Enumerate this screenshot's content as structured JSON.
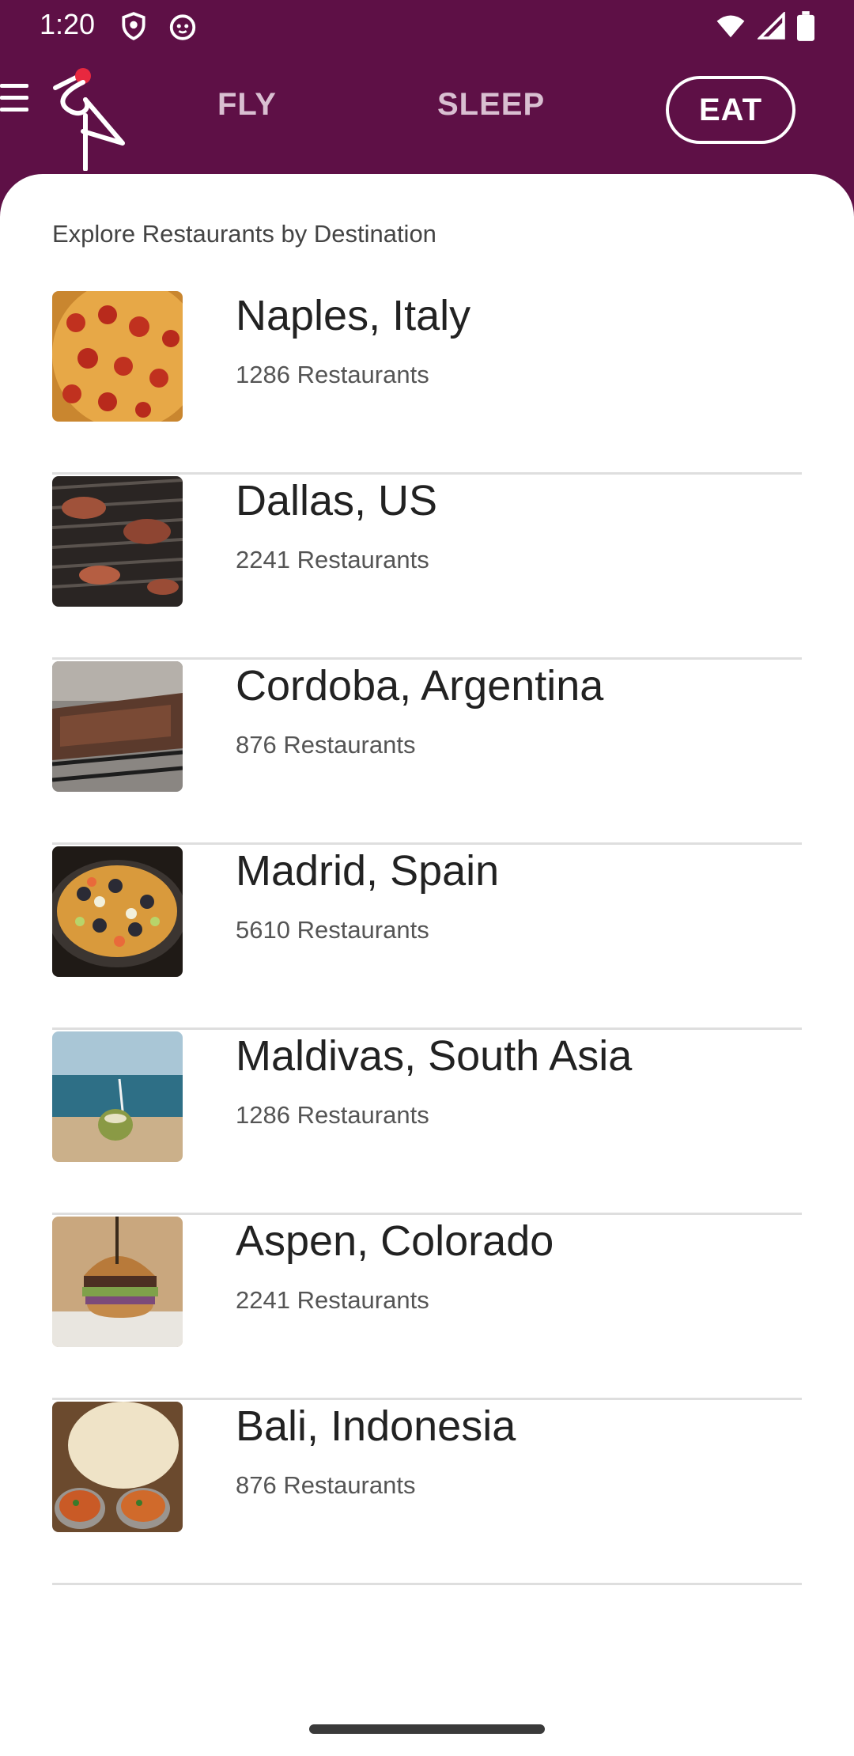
{
  "status_bar": {
    "time": "1:20",
    "icons": [
      "shield-icon",
      "cat-face-icon",
      "wifi-icon",
      "signal-icon",
      "battery-icon"
    ]
  },
  "nav": {
    "tabs": [
      {
        "label": "FLY",
        "selected": false
      },
      {
        "label": "SLEEP",
        "selected": false
      },
      {
        "label": "EAT",
        "selected": true
      }
    ]
  },
  "colors": {
    "brand": "#5e1046",
    "accent": "#e8283f",
    "sheet": "#ffffff"
  },
  "content": {
    "section_title": "Explore Restaurants by Destination",
    "destinations": [
      {
        "name": "Naples, Italy",
        "count": "1286 Restaurants",
        "image": "pizza-photo"
      },
      {
        "name": "Dallas, US",
        "count": "2241 Restaurants",
        "image": "grill-photo"
      },
      {
        "name": "Cordoba, Argentina",
        "count": "876 Restaurants",
        "image": "asado-photo"
      },
      {
        "name": "Madrid, Spain",
        "count": "5610 Restaurants",
        "image": "paella-photo"
      },
      {
        "name": "Maldivas, South Asia",
        "count": "1286 Restaurants",
        "image": "beach-coconut-photo"
      },
      {
        "name": "Aspen, Colorado",
        "count": "2241 Restaurants",
        "image": "burger-photo"
      },
      {
        "name": "Bali, Indonesia",
        "count": "876 Restaurants",
        "image": "curry-photo"
      }
    ]
  }
}
